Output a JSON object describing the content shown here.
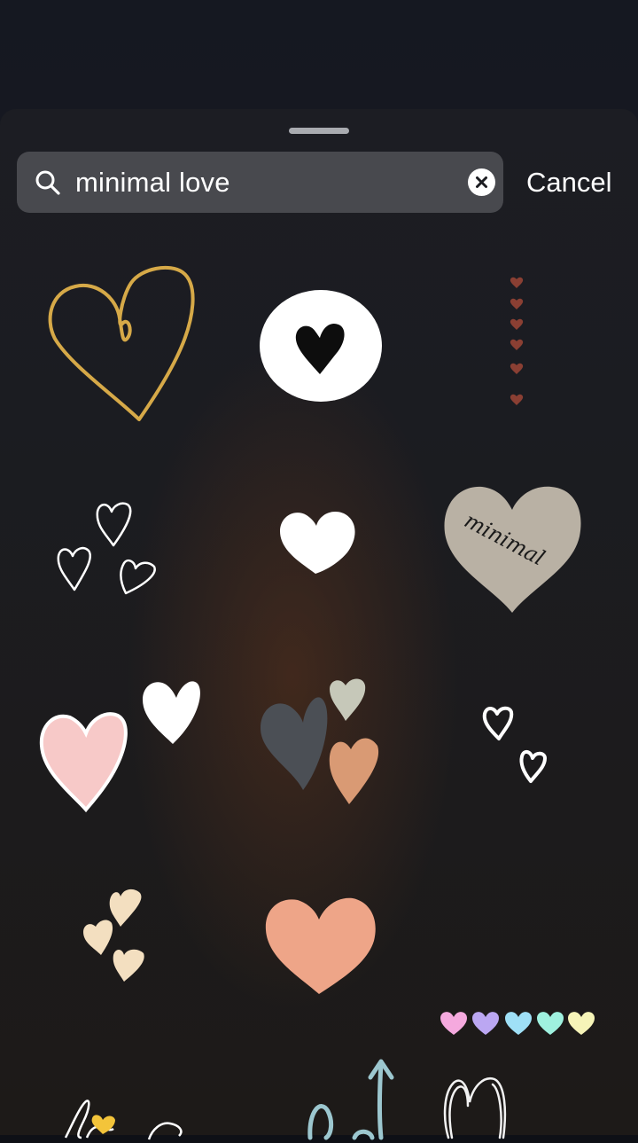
{
  "search": {
    "query": "minimal love",
    "cancel_label": "Cancel"
  },
  "stickers": [
    {
      "row": 1,
      "col": 1,
      "name": "gold-outline-heart"
    },
    {
      "row": 1,
      "col": 2,
      "name": "black-heart-in-white-circle"
    },
    {
      "row": 1,
      "col": 3,
      "name": "vertical-tiny-red-hearts"
    },
    {
      "row": 2,
      "col": 1,
      "name": "three-white-outline-hearts"
    },
    {
      "row": 2,
      "col": 2,
      "name": "white-heart"
    },
    {
      "row": 2,
      "col": 3,
      "name": "minimal-taupe-heart",
      "text": "minimal"
    },
    {
      "row": 3,
      "col": 1,
      "name": "pink-and-white-hearts"
    },
    {
      "row": 3,
      "col": 2,
      "name": "grey-sage-peach-hearts"
    },
    {
      "row": 3,
      "col": 3,
      "name": "two-small-white-outline-hearts"
    },
    {
      "row": 4,
      "col": 1,
      "name": "three-cream-hearts"
    },
    {
      "row": 4,
      "col": 2,
      "name": "peach-heart"
    },
    {
      "row": 4,
      "col": 3,
      "name": "pastel-heart-row"
    },
    {
      "row": 5,
      "col": 1,
      "name": "love-script-partial"
    },
    {
      "row": 5,
      "col": 2,
      "name": "blue-arrow-doodle"
    },
    {
      "row": 5,
      "col": 3,
      "name": "white-sketch-heart"
    }
  ],
  "colors": {
    "gold": "#d6a948",
    "tiny_hearts": "#8a3f33",
    "taupe": "#b9b1a4",
    "pink": "#f7c9c8",
    "charcoal": "#4b4f55",
    "sage": "#c6c8b9",
    "terracotta": "#d99a74",
    "cream": "#f3dfc0",
    "peach": "#eea588",
    "pastels": [
      "#f5a9de",
      "#bba7f2",
      "#9fe0f7",
      "#9ff1df",
      "#f6f4b8"
    ],
    "sky": "#9cc7cf",
    "yellow": "#f3c43a"
  }
}
